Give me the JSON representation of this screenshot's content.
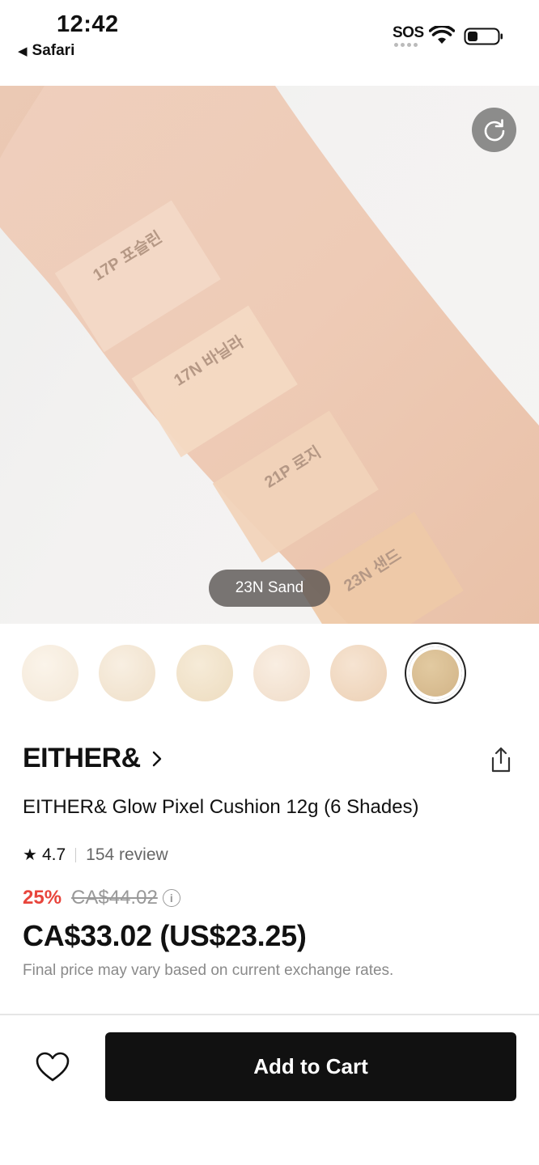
{
  "status_bar": {
    "time": "12:42",
    "back_app": "Safari",
    "sos": "SOS"
  },
  "hero": {
    "swatch_labels": [
      "17P 포슬린",
      "17N 바닐라",
      "21P 로지",
      "23N 샌드"
    ],
    "selected_shade": "23N Sand",
    "refresh_icon": "refresh-icon"
  },
  "swatches": {
    "colors": [
      "#f6ecdf",
      "#f3e4d0",
      "#f1dfc4",
      "#f4e2cf",
      "#f0d6bd",
      "#d9bf95"
    ],
    "selected_index": 5
  },
  "product": {
    "brand": "EITHER&",
    "title": "EITHER& Glow Pixel Cushion 12g (6 Shades)",
    "rating": "4.7",
    "reviews": "154 review",
    "discount": "25%",
    "original_price": "CA$44.02",
    "price": "CA$33.02 (US$23.25)",
    "fx_note": "Final price may vary based on current exchange rates."
  },
  "actions": {
    "add_to_cart": "Add to Cart"
  },
  "colors": {
    "discount_red": "#e8453c",
    "button_black": "#111111"
  }
}
